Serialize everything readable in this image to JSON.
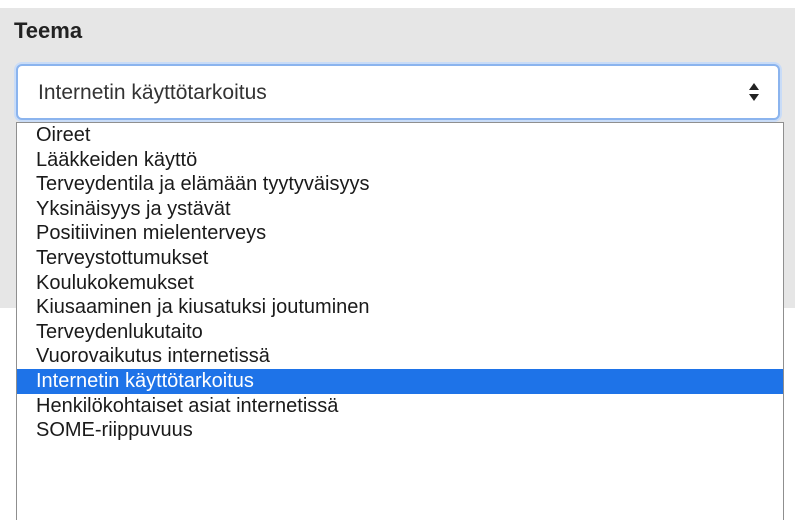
{
  "field": {
    "label": "Teema",
    "selected_value": "Internetin käyttötarkoitus",
    "arrow_icon": "up-down-arrows-icon"
  },
  "dropdown": {
    "options": [
      "Oireet",
      "Lääkkeiden käyttö",
      "Terveydentila ja elämään tyytyväisyys",
      "Yksinäisyys ja ystävät",
      "Positiivinen mielenterveys",
      "Terveystottumukset",
      "Koulukokemukset",
      "Kiusaaminen ja kiusatuksi joutuminen",
      "Terveydenlukutaito",
      "Vuorovaikutus internetissä",
      "Internetin käyttötarkoitus",
      "Henkilökohtaiset asiat internetissä",
      "SOME-riippuvuus"
    ],
    "selected_index": 10
  },
  "colors": {
    "selected_bg": "#1e73e8",
    "focus_border": "#8bb4ee",
    "panel_bg": "#e6e6e6"
  }
}
